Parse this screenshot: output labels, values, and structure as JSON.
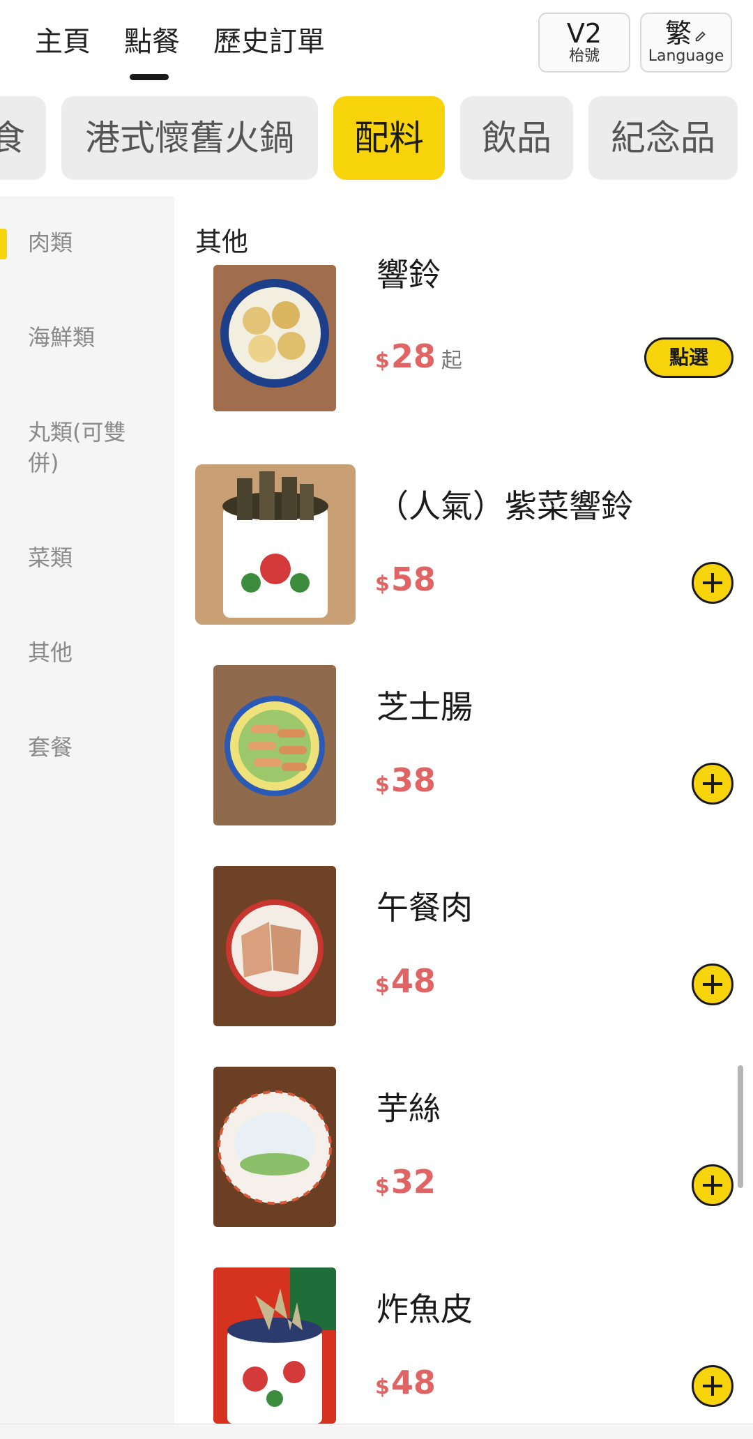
{
  "nav": {
    "tabs": [
      {
        "label": "主頁"
      },
      {
        "label": "點餐"
      },
      {
        "label": "歷史訂單"
      }
    ],
    "table_chip": {
      "main": "V2",
      "sub": "枱號"
    },
    "language_chip": {
      "main": "繁",
      "sub": "Language"
    }
  },
  "categories": [
    {
      "label": "食"
    },
    {
      "label": "港式懷舊火鍋"
    },
    {
      "label": "配料"
    },
    {
      "label": "飲品"
    },
    {
      "label": "紀念品"
    }
  ],
  "sidebar": {
    "items": [
      {
        "label": "肉類"
      },
      {
        "label": "海鮮類"
      },
      {
        "label": "丸類(可雙併)"
      },
      {
        "label": "菜類"
      },
      {
        "label": "其他"
      },
      {
        "label": "套餐"
      }
    ]
  },
  "content": {
    "section_title": "其他",
    "items": [
      {
        "name": "響鈴",
        "currency": "$",
        "price": "28",
        "suffix": "起",
        "action": "點選"
      },
      {
        "name": "（人氣）紫菜響鈴",
        "currency": "$",
        "price": "58"
      },
      {
        "name": "芝士腸",
        "currency": "$",
        "price": "38"
      },
      {
        "name": "午餐肉",
        "currency": "$",
        "price": "48"
      },
      {
        "name": "芋絲",
        "currency": "$",
        "price": "32"
      },
      {
        "name": "炸魚皮",
        "currency": "$",
        "price": "48"
      }
    ]
  },
  "colors": {
    "accent": "#f6d30a",
    "price": "#e06464",
    "sidebar_bg": "#f5f5f5"
  }
}
